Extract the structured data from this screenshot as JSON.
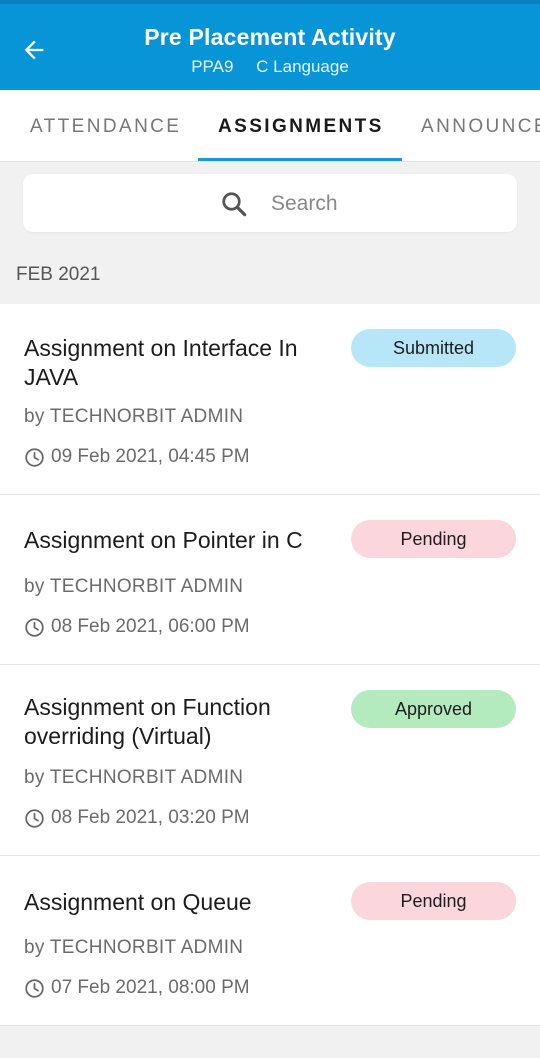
{
  "header": {
    "title": "Pre Placement Activity",
    "code": "PPA9",
    "subject": "C Language"
  },
  "tabs": [
    {
      "label": "ATTENDANCE",
      "active": false
    },
    {
      "label": "ASSIGNMENTS",
      "active": true
    },
    {
      "label": "ANNOUNCEMENTS",
      "active": false
    }
  ],
  "search": {
    "placeholder": "Search"
  },
  "section_label": "FEB 2021",
  "assignments": [
    {
      "title": "Assignment on Interface In JAVA",
      "status": "Submitted",
      "author": "by TECHNORBIT ADMIN",
      "datetime": "09 Feb 2021, 04:45 PM"
    },
    {
      "title": "Assignment on Pointer in C",
      "status": "Pending",
      "author": "by TECHNORBIT ADMIN",
      "datetime": "08 Feb 2021, 06:00 PM"
    },
    {
      "title": "Assignment on Function overriding (Virtual)",
      "status": "Approved",
      "author": "by TECHNORBIT ADMIN",
      "datetime": "08 Feb 2021, 03:20 PM"
    },
    {
      "title": "Assignment on Queue",
      "status": "Pending",
      "author": "by TECHNORBIT ADMIN",
      "datetime": "07 Feb 2021, 08:00 PM"
    }
  ],
  "colors": {
    "appbar": "#0795d8",
    "submitted": "#b7e6f8",
    "pending": "#fbd6dc",
    "approved": "#b4ebbe"
  },
  "icons": {
    "back": "arrow-left-icon",
    "search": "search-icon",
    "clock": "clock-icon"
  }
}
